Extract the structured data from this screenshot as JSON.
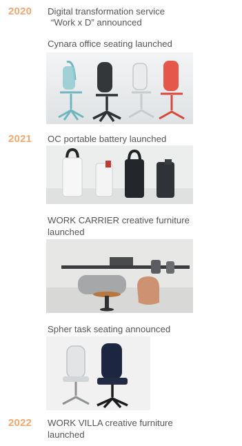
{
  "timeline": {
    "y2020": {
      "year": "2020",
      "item1_line1": "Digital transformation service",
      "item1_line2": "“Work x D” announced",
      "item2": "Cynara office seating launched"
    },
    "y2021": {
      "year": "2021",
      "item1": "OC portable battery launched",
      "item2_line1": "WORK CARRIER creative furniture",
      "item2_line2": "launched",
      "item3": "Spher task seating announced"
    },
    "y2022": {
      "year": "2022",
      "item1_line1": "WORK VILLA creative furniture",
      "item1_line2": "launched"
    }
  },
  "colors": {
    "year_accent": "#f2a76e",
    "body_text": "#555555"
  }
}
